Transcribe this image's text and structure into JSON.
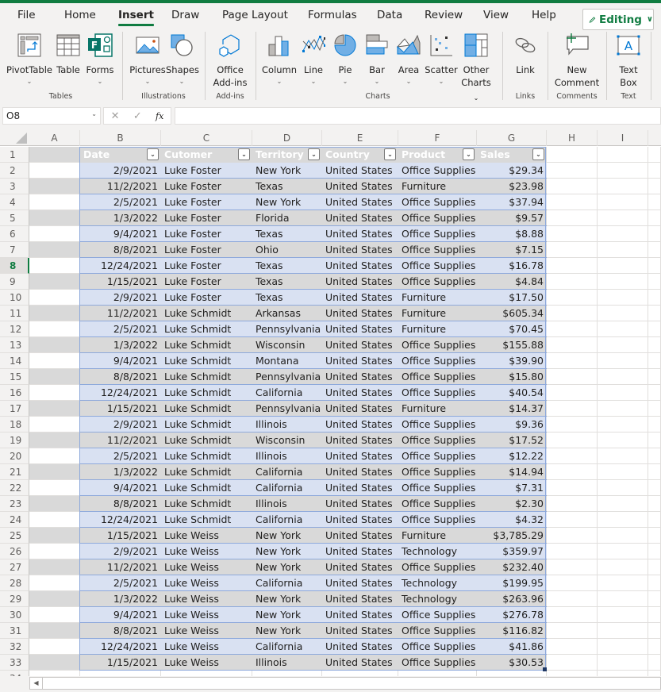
{
  "menu": {
    "tabs": [
      "File",
      "Home",
      "Insert",
      "Draw",
      "Page Layout",
      "Formulas",
      "Data",
      "Review",
      "View",
      "Help"
    ],
    "active_tab": "Insert",
    "editing_label": "Editing"
  },
  "ribbon": {
    "groups": {
      "tables": "Tables",
      "illustrations": "Illustrations",
      "addins": "Add-ins",
      "charts": "Charts",
      "links": "Links",
      "comments": "Comments",
      "text": "Text"
    },
    "buttons": {
      "pivottable": "PivotTable",
      "table": "Table",
      "forms": "Forms",
      "pictures": "Pictures",
      "shapes": "Shapes",
      "office_addins_1": "Office",
      "office_addins_2": "Add-ins",
      "column": "Column",
      "line": "Line",
      "pie": "Pie",
      "bar": "Bar",
      "area": "Area",
      "scatter": "Scatter",
      "other_charts_1": "Other",
      "other_charts_2": "Charts",
      "link": "Link",
      "new_comment_1": "New",
      "new_comment_2": "Comment",
      "text_box_1": "Text",
      "text_box_2": "Box"
    },
    "colors": {
      "accent": "#107c41",
      "icon_blue": "#0078d4",
      "forms_teal": "#077568"
    }
  },
  "formula_bar": {
    "name_box": "O8",
    "formula": ""
  },
  "sheet": {
    "columns": [
      "A",
      "B",
      "C",
      "D",
      "E",
      "F",
      "G",
      "H",
      "I"
    ],
    "selected_row": 8,
    "row_numbers": [
      1,
      2,
      3,
      4,
      5,
      6,
      7,
      8,
      9,
      10,
      11,
      12,
      13,
      14,
      15,
      16,
      17,
      18,
      19,
      20,
      21,
      22,
      23,
      24,
      25,
      26,
      27,
      28,
      29,
      30,
      31,
      32,
      33,
      34
    ],
    "table_headers": [
      "Date",
      "Cutomer",
      "Territory",
      "Country",
      "Product",
      "Sales"
    ],
    "rows": [
      [
        "2/9/2021",
        "Luke Foster",
        "New York",
        "United States",
        "Office Supplies",
        "$29.34"
      ],
      [
        "11/2/2021",
        "Luke Foster",
        "Texas",
        "United States",
        "Furniture",
        "$23.98"
      ],
      [
        "2/5/2021",
        "Luke Foster",
        "New York",
        "United States",
        "Office Supplies",
        "$37.94"
      ],
      [
        "1/3/2022",
        "Luke Foster",
        "Florida",
        "United States",
        "Office Supplies",
        "$9.57"
      ],
      [
        "9/4/2021",
        "Luke Foster",
        "Texas",
        "United States",
        "Office Supplies",
        "$8.88"
      ],
      [
        "8/8/2021",
        "Luke Foster",
        "Ohio",
        "United States",
        "Office Supplies",
        "$7.15"
      ],
      [
        "12/24/2021",
        "Luke Foster",
        "Texas",
        "United States",
        "Office Supplies",
        "$16.78"
      ],
      [
        "1/15/2021",
        "Luke Foster",
        "Texas",
        "United States",
        "Office Supplies",
        "$4.84"
      ],
      [
        "2/9/2021",
        "Luke Foster",
        "Texas",
        "United States",
        "Furniture",
        "$17.50"
      ],
      [
        "11/2/2021",
        "Luke Schmidt",
        "Arkansas",
        "United States",
        "Furniture",
        "$605.34"
      ],
      [
        "2/5/2021",
        "Luke Schmidt",
        "Pennsylvania",
        "United States",
        "Furniture",
        "$70.45"
      ],
      [
        "1/3/2022",
        "Luke Schmidt",
        "Wisconsin",
        "United States",
        "Office Supplies",
        "$155.88"
      ],
      [
        "9/4/2021",
        "Luke Schmidt",
        "Montana",
        "United States",
        "Office Supplies",
        "$39.90"
      ],
      [
        "8/8/2021",
        "Luke Schmidt",
        "Pennsylvania",
        "United States",
        "Office Supplies",
        "$15.80"
      ],
      [
        "12/24/2021",
        "Luke Schmidt",
        "California",
        "United States",
        "Office Supplies",
        "$40.54"
      ],
      [
        "1/15/2021",
        "Luke Schmidt",
        "Pennsylvania",
        "United States",
        "Furniture",
        "$14.37"
      ],
      [
        "2/9/2021",
        "Luke Schmidt",
        "Illinois",
        "United States",
        "Office Supplies",
        "$9.36"
      ],
      [
        "11/2/2021",
        "Luke Schmidt",
        "Wisconsin",
        "United States",
        "Office Supplies",
        "$17.52"
      ],
      [
        "2/5/2021",
        "Luke Schmidt",
        "Illinois",
        "United States",
        "Office Supplies",
        "$12.22"
      ],
      [
        "1/3/2022",
        "Luke Schmidt",
        "California",
        "United States",
        "Office Supplies",
        "$14.94"
      ],
      [
        "9/4/2021",
        "Luke Schmidt",
        "California",
        "United States",
        "Office Supplies",
        "$7.31"
      ],
      [
        "8/8/2021",
        "Luke Schmidt",
        "Illinois",
        "United States",
        "Office Supplies",
        "$2.30"
      ],
      [
        "12/24/2021",
        "Luke Schmidt",
        "California",
        "United States",
        "Office Supplies",
        "$4.32"
      ],
      [
        "1/15/2021",
        "Luke Weiss",
        "New York",
        "United States",
        "Furniture",
        "$3,785.29"
      ],
      [
        "2/9/2021",
        "Luke Weiss",
        "New York",
        "United States",
        "Technology",
        "$359.97"
      ],
      [
        "11/2/2021",
        "Luke Weiss",
        "New York",
        "United States",
        "Office Supplies",
        "$232.40"
      ],
      [
        "2/5/2021",
        "Luke Weiss",
        "California",
        "United States",
        "Technology",
        "$199.95"
      ],
      [
        "1/3/2022",
        "Luke Weiss",
        "New York",
        "United States",
        "Technology",
        "$263.96"
      ],
      [
        "9/4/2021",
        "Luke Weiss",
        "New York",
        "United States",
        "Office Supplies",
        "$276.78"
      ],
      [
        "8/8/2021",
        "Luke Weiss",
        "New York",
        "United States",
        "Office Supplies",
        "$116.82"
      ],
      [
        "12/24/2021",
        "Luke Weiss",
        "California",
        "United States",
        "Office Supplies",
        "$41.86"
      ],
      [
        "1/15/2021",
        "Luke Weiss",
        "Illinois",
        "United States",
        "Office Supplies",
        "$30.53"
      ]
    ],
    "colors": {
      "band_odd": "#d9e1f2",
      "band_even": "#d9d9d9",
      "header_bg": "#d9d9d9",
      "table_border": "#8ea9db"
    }
  }
}
